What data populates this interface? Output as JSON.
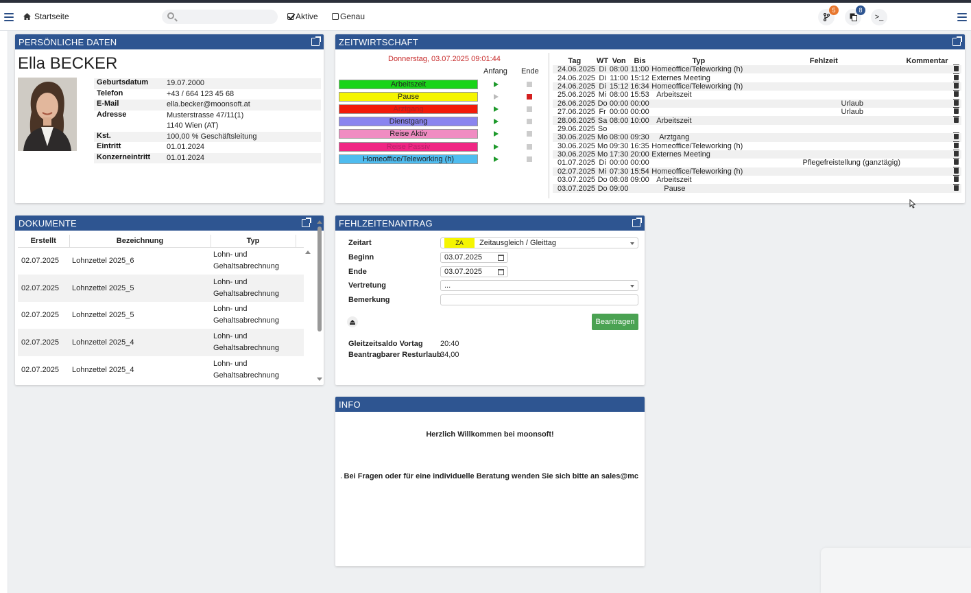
{
  "topbar": {
    "home_label": "Startseite",
    "search_placeholder": "",
    "aktive_label": "Aktive",
    "genau_label": "Genau",
    "notif1_count": "5",
    "notif2_count": "8",
    "console_label": ">_"
  },
  "personal": {
    "title": "PERSÖNLICHE DATEN",
    "name": "Ella BECKER",
    "rows": [
      {
        "k": "Geburtsdatum",
        "v": "19.07.2000"
      },
      {
        "k": "Telefon",
        "v": "+43 / 664 123 45 68"
      },
      {
        "k": "E-Mail",
        "v": "ella.becker@moonsoft.at"
      },
      {
        "k": "Adresse",
        "v": "Musterstrasse 47/11(1)"
      },
      {
        "k": "",
        "v": "1140 Wien (AT)"
      },
      {
        "k": "Kst.",
        "v": "100,00 %   Geschäftsleitung"
      },
      {
        "k": "Eintritt",
        "v": "01.01.2024"
      },
      {
        "k": "Konzerneintritt",
        "v": "01.01.2024"
      }
    ]
  },
  "zeit": {
    "title": "ZEITWIRTSCHAFT",
    "clock": "Donnerstag, 03.07.2025 09:01:44",
    "anfang": "Anfang",
    "ende": "Ende",
    "types": [
      {
        "label": "Arbeitszeit",
        "color": "#18d418",
        "text": "#222",
        "play": true,
        "stop": false
      },
      {
        "label": "Pause",
        "color": "#f5f500",
        "text": "#222",
        "play": false,
        "stop": true
      },
      {
        "label": "Arztgang",
        "color": "#f21a0a",
        "text": "#b02020",
        "play": true,
        "stop": false
      },
      {
        "label": "Dienstgang",
        "color": "#8a84ef",
        "text": "#222",
        "play": true,
        "stop": false
      },
      {
        "label": "Reise Aktiv",
        "color": "#f08cc2",
        "text": "#222",
        "play": true,
        "stop": false
      },
      {
        "label": "Reise Passiv",
        "color": "#f02684",
        "text": "#b8206a",
        "play": true,
        "stop": false
      },
      {
        "label": "Homeoffice/Teleworking (h)",
        "color": "#4fbcef",
        "text": "#222",
        "play": true,
        "stop": false
      }
    ],
    "headers": [
      "Tag",
      "WT",
      "Von",
      "Bis",
      "Typ",
      "Fehlzeit",
      "Kommentar"
    ],
    "rows": [
      {
        "tag": "24.06.2025",
        "wt": "Di",
        "von": "08:00",
        "bis": "11:00",
        "typ": "Homeoffice/Teleworking (h)",
        "fz": "",
        "del": true
      },
      {
        "tag": "24.06.2025",
        "wt": "Di",
        "von": "11:00",
        "bis": "15:12",
        "typ": "Externes Meeting",
        "fz": "",
        "del": true
      },
      {
        "tag": "24.06.2025",
        "wt": "Di",
        "von": "15:12",
        "bis": "16:34",
        "typ": "Homeoffice/Teleworking (h)",
        "fz": "",
        "del": true
      },
      {
        "tag": "25.06.2025",
        "wt": "Mi",
        "von": "08:00",
        "bis": "15:53",
        "typ": "Arbeitszeit",
        "fz": "",
        "del": true
      },
      {
        "tag": "26.06.2025",
        "wt": "Do",
        "von": "00:00",
        "bis": "00:00",
        "typ": "",
        "fz": "Urlaub",
        "del": true
      },
      {
        "tag": "27.06.2025",
        "wt": "Fr",
        "von": "00:00",
        "bis": "00:00",
        "typ": "",
        "fz": "Urlaub",
        "del": true
      },
      {
        "tag": "28.06.2025",
        "wt": "Sa",
        "von": "08:00",
        "bis": "10:00",
        "typ": "Arbeitszeit",
        "fz": "",
        "del": true
      },
      {
        "tag": "29.06.2025",
        "wt": "So",
        "von": "",
        "bis": "",
        "typ": "",
        "fz": "",
        "del": false
      },
      {
        "tag": "30.06.2025",
        "wt": "Mo",
        "von": "08:00",
        "bis": "09:30",
        "typ": "Arztgang",
        "fz": "",
        "del": true
      },
      {
        "tag": "30.06.2025",
        "wt": "Mo",
        "von": "09:30",
        "bis": "16:35",
        "typ": "Homeoffice/Teleworking (h)",
        "fz": "",
        "del": true
      },
      {
        "tag": "30.06.2025",
        "wt": "Mo",
        "von": "17:30",
        "bis": "20:00",
        "typ": "Externes Meeting",
        "fz": "",
        "del": true
      },
      {
        "tag": "01.07.2025",
        "wt": "Di",
        "von": "00:00",
        "bis": "00:00",
        "typ": "",
        "fz": "Pflegefreistellung (ganztägig)",
        "del": true
      },
      {
        "tag": "02.07.2025",
        "wt": "Mi",
        "von": "07:30",
        "bis": "15:54",
        "typ": "Homeoffice/Teleworking (h)",
        "fz": "",
        "del": true
      },
      {
        "tag": "03.07.2025",
        "wt": "Do",
        "von": "08:08",
        "bis": "09:00",
        "typ": "Arbeitszeit",
        "fz": "",
        "del": true
      },
      {
        "tag": "03.07.2025",
        "wt": "Do",
        "von": "09:00",
        "bis": "",
        "typ": "Pause",
        "fz": "",
        "del": true
      }
    ]
  },
  "docs": {
    "title": "DOKUMENTE",
    "headers": [
      "Erstellt",
      "Bezeichnung",
      "Typ"
    ],
    "rows": [
      {
        "d": "02.07.2025",
        "b": "Lohnzettel 2025_6",
        "t1": "Lohn- und",
        "t2": "Gehaltsabrechnung"
      },
      {
        "d": "02.07.2025",
        "b": "Lohnzettel 2025_5",
        "t1": "Lohn- und",
        "t2": "Gehaltsabrechnung"
      },
      {
        "d": "02.07.2025",
        "b": "Lohnzettel 2025_5",
        "t1": "Lohn- und",
        "t2": "Gehaltsabrechnung"
      },
      {
        "d": "02.07.2025",
        "b": "Lohnzettel 2025_4",
        "t1": "Lohn- und",
        "t2": "Gehaltsabrechnung"
      },
      {
        "d": "02.07.2025",
        "b": "Lohnzettel 2025_4",
        "t1": "Lohn- und",
        "t2": "Gehaltsabrechnung"
      }
    ]
  },
  "fehl": {
    "title": "FEHLZEITENANTRAG",
    "zeitart_label": "Zeitart",
    "zeitart_code": "ZA",
    "zeitart_value": "Zeitausgleich / Gleittag",
    "zeitart_color": "#f5f500",
    "beginn_label": "Beginn",
    "beginn_value": "03.07.2025",
    "ende_label": "Ende",
    "ende_value": "03.07.2025",
    "vertretung_label": "Vertretung",
    "vertretung_value": "...",
    "bemerkung_label": "Bemerkung",
    "bemerkung_value": "",
    "submit": "Beantragen",
    "saldo_label": "Gleitzeitsaldo Vortag",
    "saldo_value": "20:40",
    "urlaub_label": "Beantragbarer Resturlaub",
    "urlaub_value": "34,00"
  },
  "info": {
    "title": "INFO",
    "welcome": "Herzlich Willkommen bei moonsoft!",
    "text": "ıgebung. Bei Fragen oder für eine individuelle Beratung wenden Sie sich bitte an sales@mc"
  },
  "colors": {
    "header": "#2e5591",
    "accent_button": "#4aa252",
    "badge_orange": "#e8772e",
    "badge_blue": "#2e5591"
  }
}
